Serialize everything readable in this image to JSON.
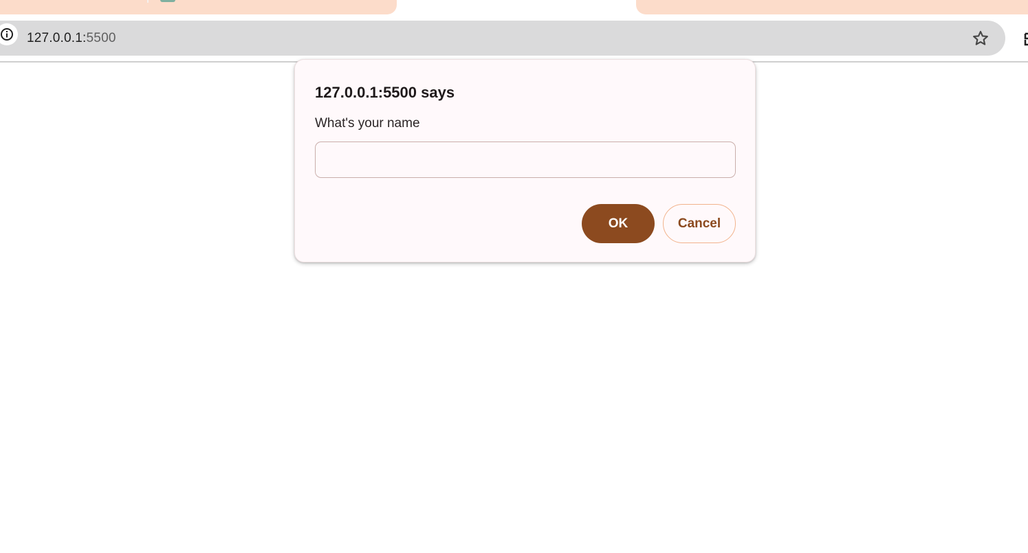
{
  "browser": {
    "url_host": "127.0.0.1:",
    "url_port": "5500",
    "site_info_icon": "info-icon",
    "bookmark_icon": "star-icon"
  },
  "dialog": {
    "title": "127.0.0.1:5500 says",
    "message": "What's your name",
    "input_value": "",
    "ok_label": "OK",
    "cancel_label": "Cancel"
  },
  "colors": {
    "tab_accent": "#fcdcca",
    "ok_button": "#8c4a1f",
    "cancel_border": "#f2b38c",
    "dialog_bg": "#fff9fb"
  }
}
